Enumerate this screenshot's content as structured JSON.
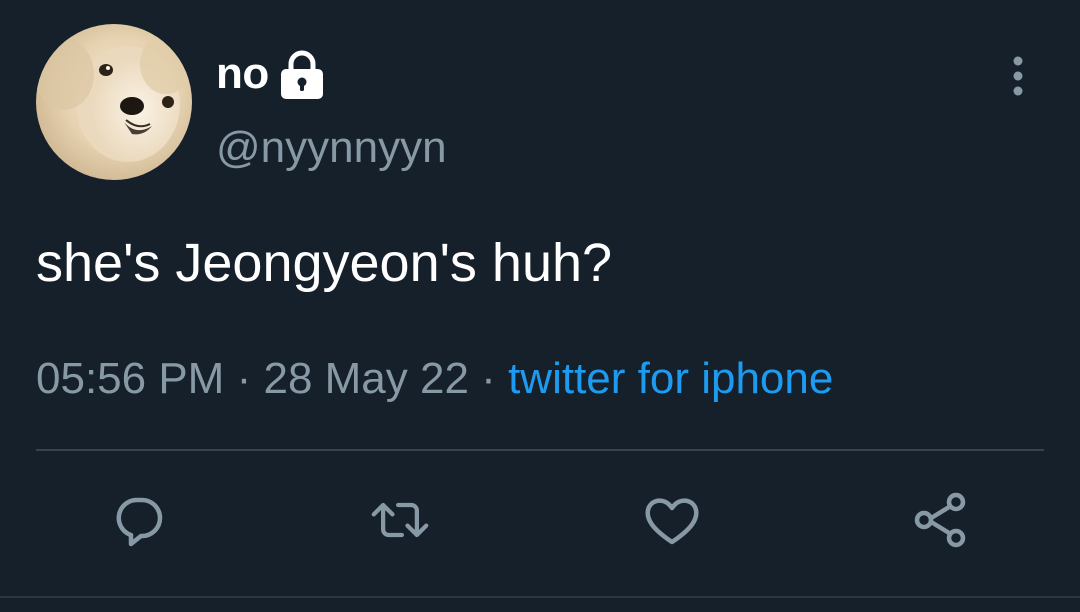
{
  "tweet": {
    "author": {
      "display_name": "no",
      "handle": "@nyynnyyn",
      "avatar": "pomeranian-dog-avatar",
      "protected_icon": "lock-icon"
    },
    "menu_icon": "more-vertical-icon",
    "text": "she's Jeongyeon's huh?",
    "time": "05:56 PM",
    "separator": "·",
    "date": "28 May 22",
    "source": "twitter for iphone"
  },
  "actions": [
    {
      "icon": "reply-icon"
    },
    {
      "icon": "retweet-icon"
    },
    {
      "icon": "like-icon"
    },
    {
      "icon": "share-icon"
    }
  ],
  "colors": {
    "background": "#15202b",
    "primary_text": "#ffffff",
    "secondary_text": "#8899a6",
    "link": "#1d9bf0",
    "divider": "#38444d"
  }
}
